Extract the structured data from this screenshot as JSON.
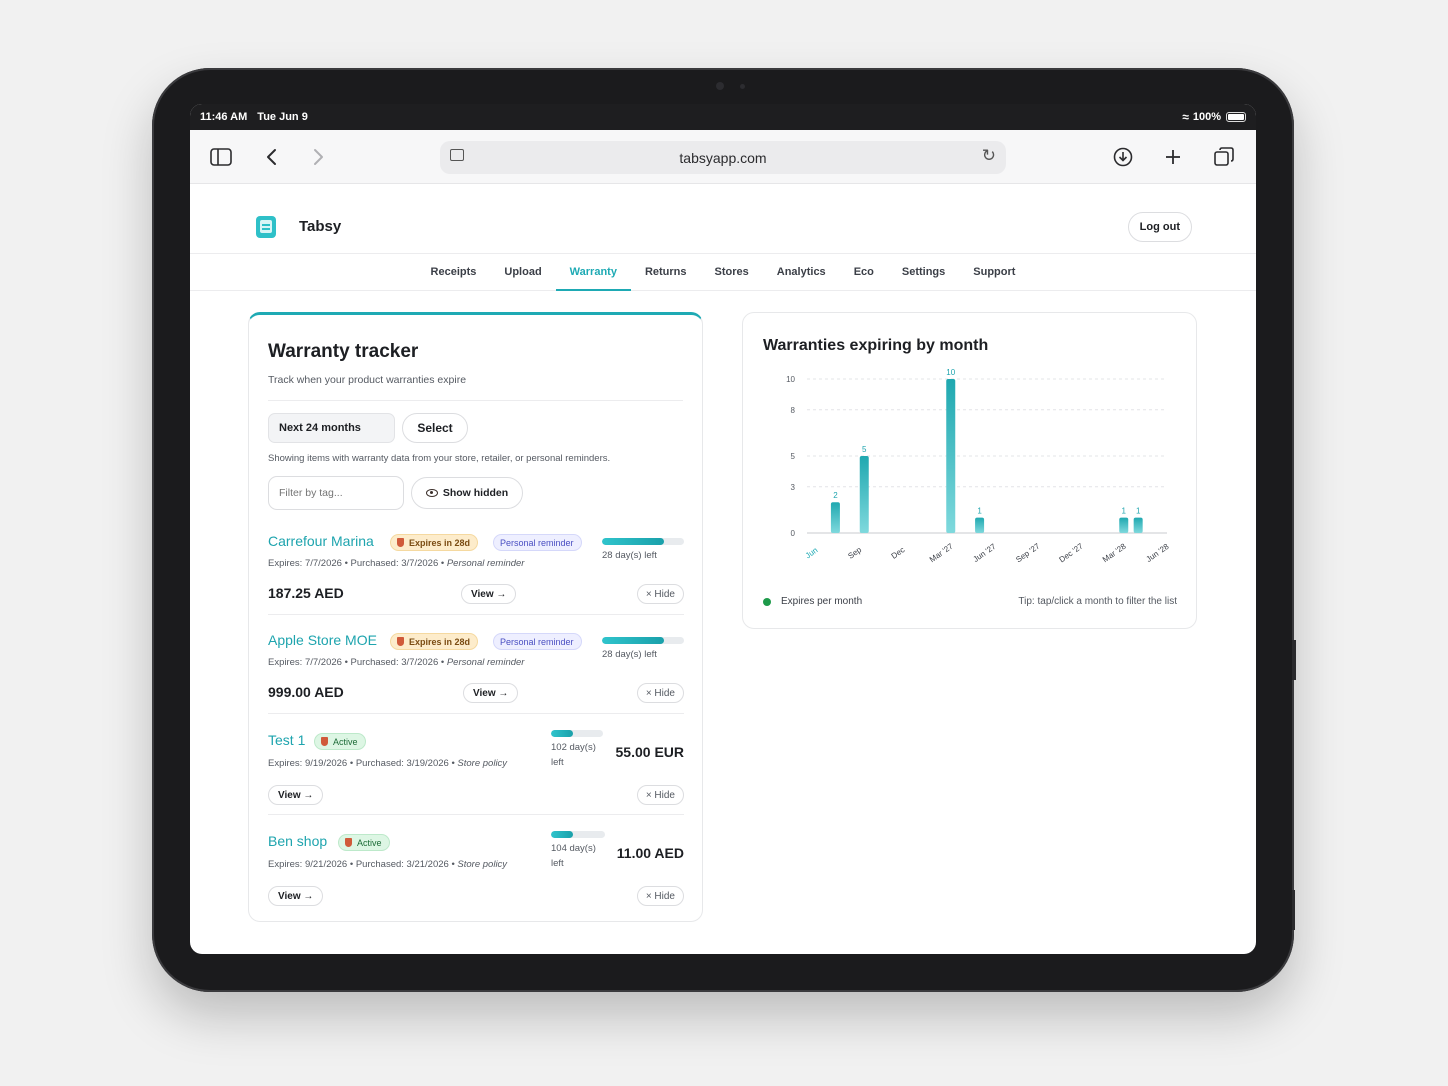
{
  "status_bar": {
    "time": "11:46 AM",
    "date": "Tue Jun 9",
    "battery": "100%"
  },
  "browser": {
    "url": "tabsyapp.com"
  },
  "app": {
    "name": "Tabsy",
    "logout_label": "Log out"
  },
  "nav": {
    "items": [
      {
        "label": "Receipts"
      },
      {
        "label": "Upload"
      },
      {
        "label": "Warranty"
      },
      {
        "label": "Returns"
      },
      {
        "label": "Stores"
      },
      {
        "label": "Analytics"
      },
      {
        "label": "Eco"
      },
      {
        "label": "Settings"
      },
      {
        "label": "Support"
      }
    ],
    "active": "Warranty"
  },
  "tracker": {
    "title": "Warranty tracker",
    "subtitle": "Track when your product warranties expire",
    "range_label": "Next 24 months",
    "select_label": "Select",
    "info": "Showing items with warranty data from your store, retailer, or personal reminders.",
    "filter_placeholder": "Filter by tag...",
    "show_hidden_label": "Show hidden",
    "view_label": "View →",
    "hide_label": "× Hide",
    "items": [
      {
        "name": "Carrefour Marina",
        "badge": "Expires in 28d",
        "reminder": "Personal reminder",
        "expires": "Expires: 7/7/2026",
        "purchased": "Purchased: 3/7/2026",
        "source": "Personal reminder",
        "price": "187.25 AED",
        "days_left": "28 day(s) left",
        "progress": 0.75
      },
      {
        "name": "Apple Store MOE",
        "badge": "Expires in 28d",
        "reminder": "Personal reminder",
        "expires": "Expires: 7/7/2026",
        "purchased": "Purchased: 3/7/2026",
        "source": "Personal reminder",
        "price": "999.00 AED",
        "days_left": "28 day(s) left",
        "progress": 0.75
      },
      {
        "name": "Test 1",
        "badge": "Active",
        "expires": "Expires: 9/19/2026",
        "purchased": "Purchased: 3/19/2026",
        "source": "Store policy",
        "price": "55.00 EUR",
        "days_left_num": "102 day(s)",
        "days_left_word": "left",
        "progress": 0.42
      },
      {
        "name": "Ben shop",
        "badge": "Active",
        "expires": "Expires: 9/21/2026",
        "purchased": "Purchased: 3/21/2026",
        "source": "Store policy",
        "price": "11.00 AED",
        "days_left_num": "104 day(s)",
        "days_left_word": "left",
        "progress": 0.41
      }
    ]
  },
  "chart_data": {
    "type": "bar",
    "title": "Warranties expiring by month",
    "x_tick_labels": [
      "Jun",
      "Sep",
      "Dec",
      "Mar '27",
      "Jun '27",
      "Sep '27",
      "Dec '27",
      "Mar '28",
      "Jun '28"
    ],
    "y_ticks": [
      0,
      3,
      5,
      8,
      10
    ],
    "ylim": [
      0,
      10
    ],
    "bars": [
      {
        "month_index": 1,
        "value": 2
      },
      {
        "month_index": 3,
        "value": 5
      },
      {
        "month_index": 9,
        "value": 10
      },
      {
        "month_index": 11,
        "value": 1
      },
      {
        "month_index": 21,
        "value": 1
      },
      {
        "month_index": 22,
        "value": 1
      }
    ],
    "months_total": 25,
    "legend": "Expires per month",
    "legend_position": "bottom-left",
    "grid": true,
    "tip": "Tip: tap/click a month to filter the list",
    "colors": {
      "bar": "#2bb8bf",
      "highlight_tick": "#1eaab4",
      "legend_dot": "#1e9a4a"
    }
  },
  "colors": {
    "accent": "#1eaab4"
  }
}
